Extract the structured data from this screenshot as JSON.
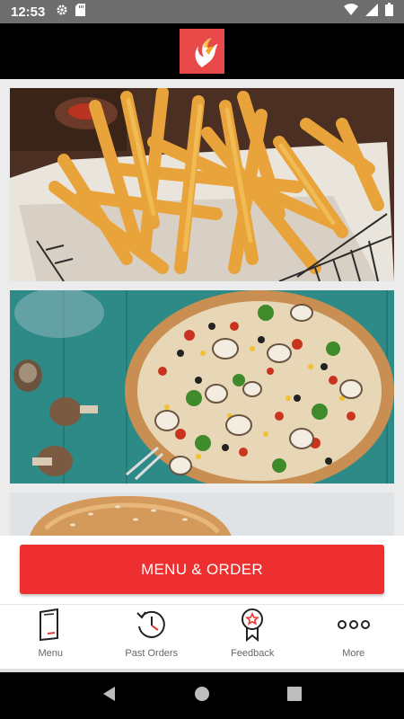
{
  "status_bar": {
    "time": "12:53",
    "left_icons": [
      "gear-icon",
      "sd-card-icon"
    ],
    "right_icons": [
      "wifi-icon",
      "signal-icon",
      "battery-icon"
    ]
  },
  "header": {
    "logo_icon": "phoenix-logo-icon",
    "logo_color": "#e84a4a"
  },
  "tiles": [
    {
      "name": "fries",
      "icon": "french-fries-photo"
    },
    {
      "name": "pizza",
      "icon": "pizza-photo"
    },
    {
      "name": "burger",
      "icon": "burger-photo"
    }
  ],
  "cta": {
    "label": "MENU & ORDER",
    "color": "#ee2f2f"
  },
  "bottom_nav": {
    "items": [
      {
        "label": "Menu",
        "icon": "menu-book-icon"
      },
      {
        "label": "Past Orders",
        "icon": "history-clock-icon"
      },
      {
        "label": "Feedback",
        "icon": "award-ribbon-icon"
      },
      {
        "label": "More",
        "icon": "more-dots-icon"
      }
    ]
  },
  "system_nav": {
    "icons": [
      "back-icon",
      "home-icon",
      "recents-icon"
    ]
  }
}
